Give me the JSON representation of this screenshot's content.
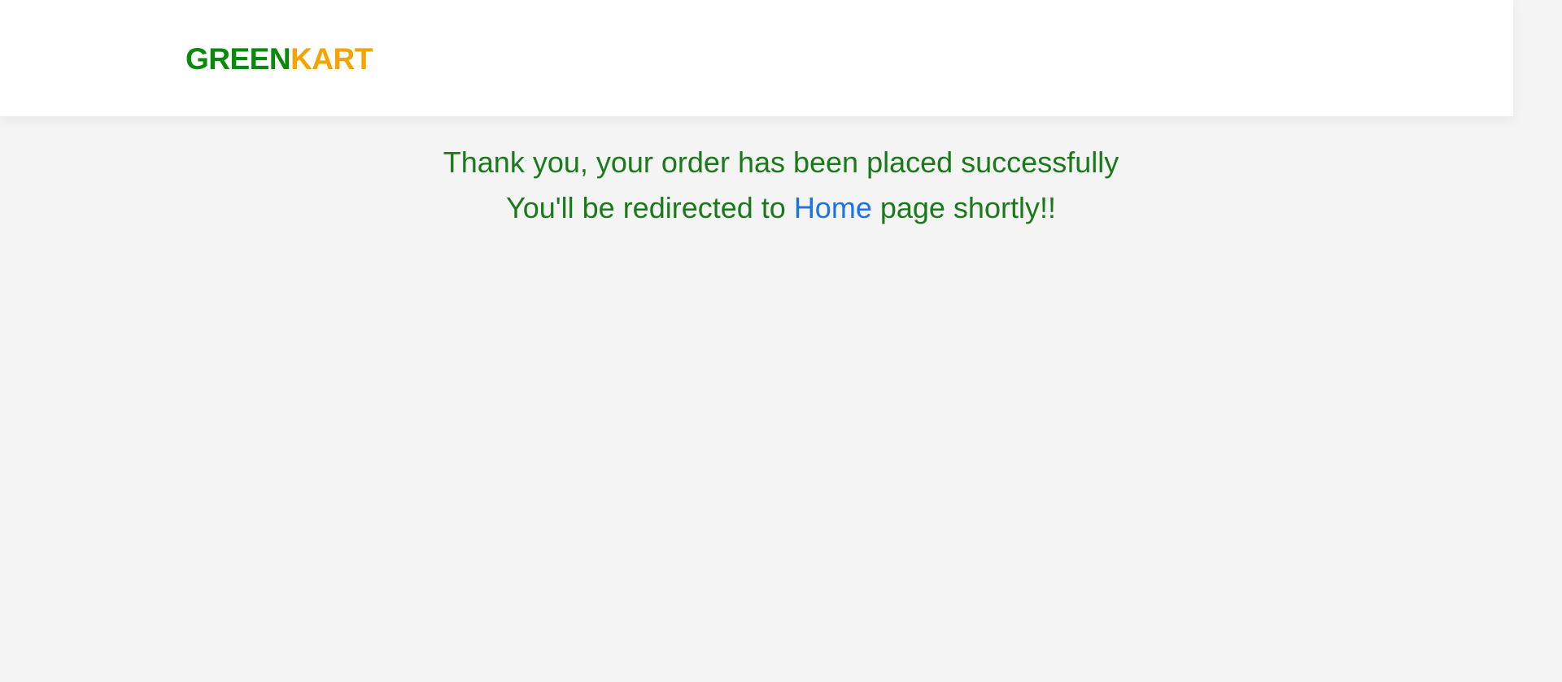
{
  "header": {
    "brand_first": "GREEN",
    "brand_second": "KART"
  },
  "confirmation": {
    "line1": "Thank you, your order has been placed successfully",
    "line2_prefix": "You'll be redirected to ",
    "home_link": "Home",
    "line2_suffix": " page shortly!!"
  },
  "colors": {
    "brand_green": "#0a8a0a",
    "brand_orange": "#f5a300",
    "message_green": "#1a7a1a",
    "link_blue": "#1a73e8",
    "page_background": "#f4f4f4",
    "header_background": "#ffffff"
  }
}
